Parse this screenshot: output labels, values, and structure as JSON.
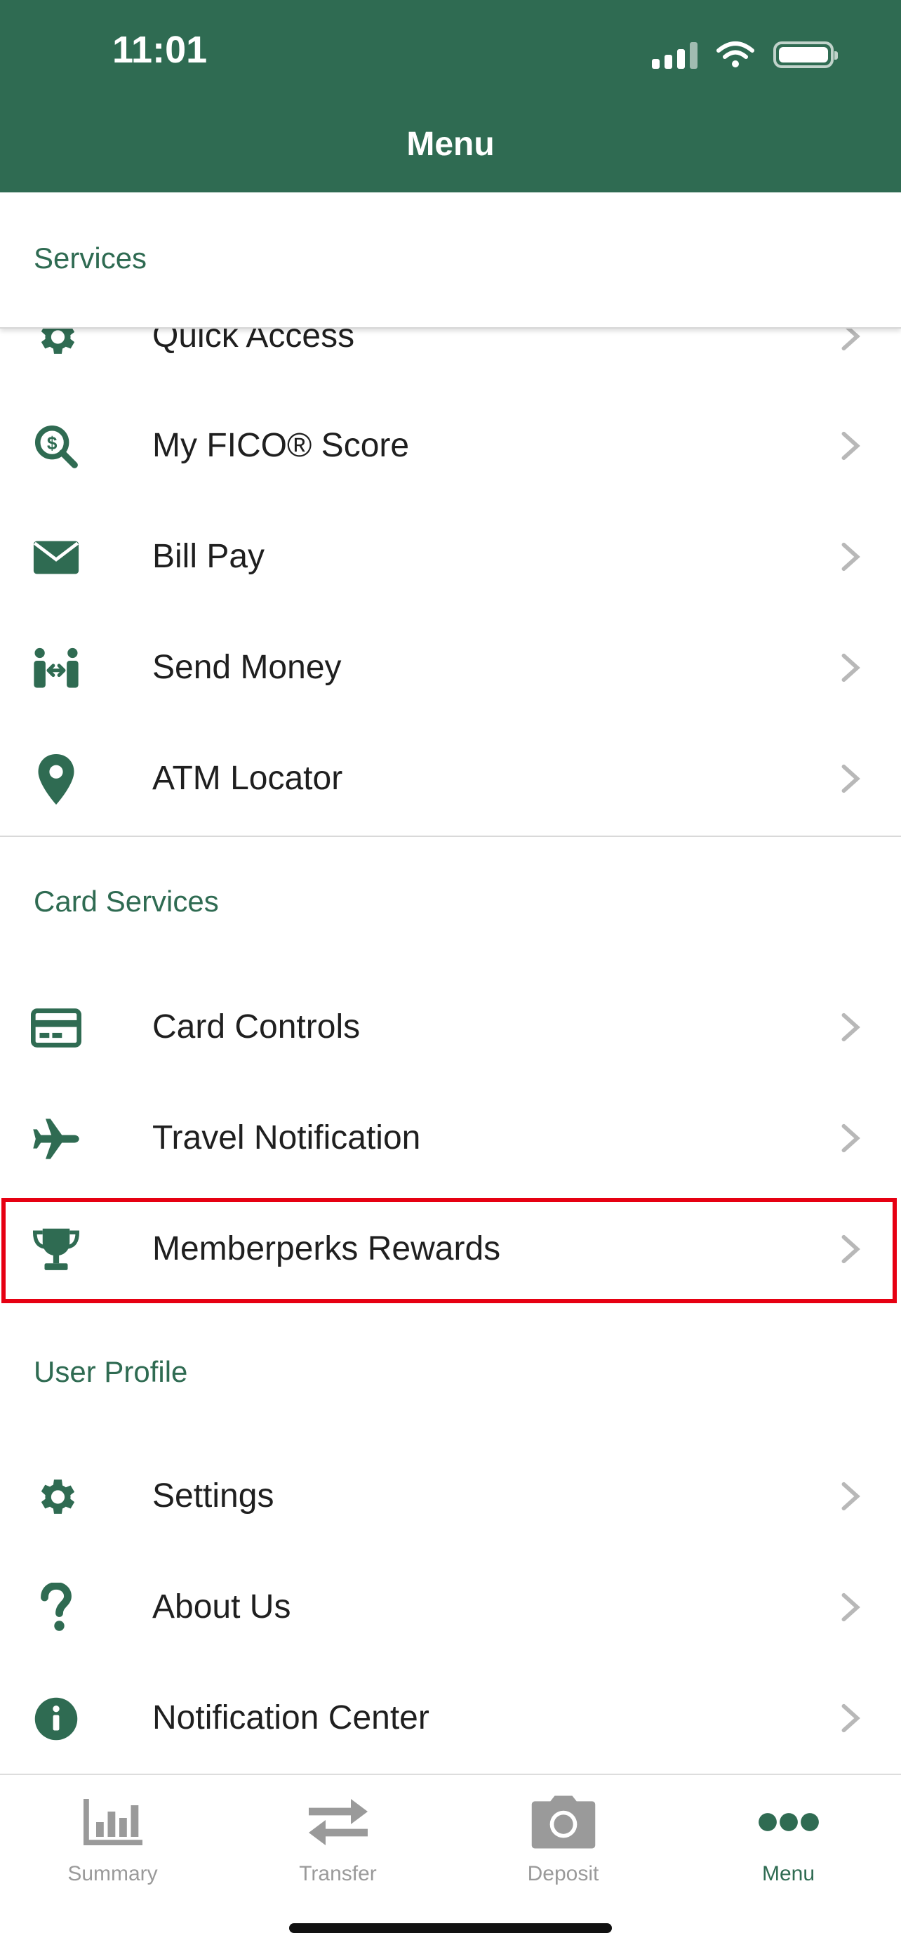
{
  "status_bar": {
    "time": "11:01"
  },
  "header": {
    "title": "Menu"
  },
  "sections": [
    {
      "title": "Services",
      "items": [
        {
          "label": "Quick Access",
          "icon": "gear-icon"
        },
        {
          "label": "My FICO® Score",
          "icon": "dollar-search-icon"
        },
        {
          "label": "Bill Pay",
          "icon": "envelope-icon"
        },
        {
          "label": "Send Money",
          "icon": "people-transfer-icon"
        },
        {
          "label": "ATM Locator",
          "icon": "map-pin-icon"
        }
      ]
    },
    {
      "title": "Card Services",
      "items": [
        {
          "label": "Card Controls",
          "icon": "credit-card-icon"
        },
        {
          "label": "Travel Notification",
          "icon": "airplane-icon"
        },
        {
          "label": "Memberperks Rewards",
          "icon": "trophy-icon"
        }
      ]
    },
    {
      "title": "User Profile",
      "items": [
        {
          "label": "Settings",
          "icon": "gear-icon"
        },
        {
          "label": "About Us",
          "icon": "question-icon"
        },
        {
          "label": "Notification Center",
          "icon": "info-icon"
        }
      ]
    }
  ],
  "tabbar": {
    "tabs": [
      {
        "label": "Summary",
        "icon": "bar-chart-icon",
        "active": false
      },
      {
        "label": "Transfer",
        "icon": "arrows-transfer-icon",
        "active": false
      },
      {
        "label": "Deposit",
        "icon": "camera-icon",
        "active": false
      },
      {
        "label": "Menu",
        "icon": "dots-icon",
        "active": true
      }
    ]
  },
  "colors": {
    "brand": "#2f6b52",
    "highlight": "#e60012",
    "inactive": "#9a9a9a"
  }
}
